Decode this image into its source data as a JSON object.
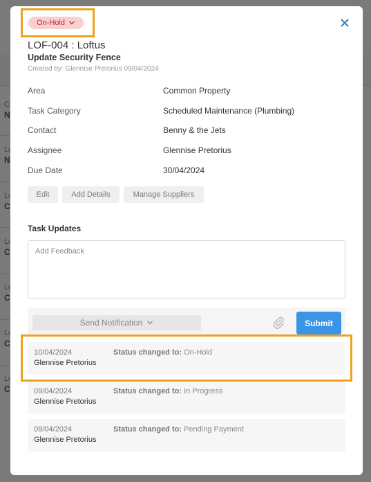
{
  "background": {
    "rows": [
      {
        "line1": "C",
        "line2": "N"
      },
      {
        "line1": "Lo",
        "line2": "N"
      },
      {
        "line1": "Lo",
        "line2": "C"
      },
      {
        "line1": "Lo",
        "line2": "C"
      },
      {
        "line1": "Lo",
        "line2": "C"
      },
      {
        "line1": "Lo",
        "line2": "C"
      },
      {
        "line1": "Lo",
        "line2": "C"
      }
    ]
  },
  "modal": {
    "status_pill": "On-Hold",
    "title": "LOF-004 : Loftus",
    "subtitle": "Update Security Fence",
    "created_by": "Created by: Glennise Pretorius 09/04/2024",
    "details": [
      {
        "label": "Area",
        "value": "Common Property"
      },
      {
        "label": "Task Category",
        "value": "Scheduled Maintenance (Plumbing)"
      },
      {
        "label": "Contact",
        "value": "Benny & the Jets"
      },
      {
        "label": "Assignee",
        "value": "Glennise Pretorius"
      },
      {
        "label": "Due Date",
        "value": "30/04/2024"
      }
    ],
    "actions": {
      "edit": "Edit",
      "add_details": "Add Details",
      "manage_suppliers": "Manage Suppliers"
    },
    "task_updates": {
      "title": "Task Updates",
      "feedback_placeholder": "Add Feedback",
      "send_notification": "Send Notification",
      "submit": "Submit"
    },
    "updates": [
      {
        "date": "10/04/2024",
        "user": "Glennise Pretorius",
        "status_label": "Status changed to:",
        "status": "On-Hold"
      },
      {
        "date": "09/04/2024",
        "user": "Glennise Pretorius",
        "status_label": "Status changed to:",
        "status": "In Progress"
      },
      {
        "date": "09/04/2024",
        "user": "Glennise Pretorius",
        "status_label": "Status changed to:",
        "status": "Pending Payment"
      }
    ]
  },
  "colors": {
    "status_pill_bg": "#f8d0d2",
    "status_pill_text": "#c0262d",
    "submit_bg": "#3a95e6",
    "highlight": "#f0a11c",
    "close_icon": "#2a86c8"
  }
}
